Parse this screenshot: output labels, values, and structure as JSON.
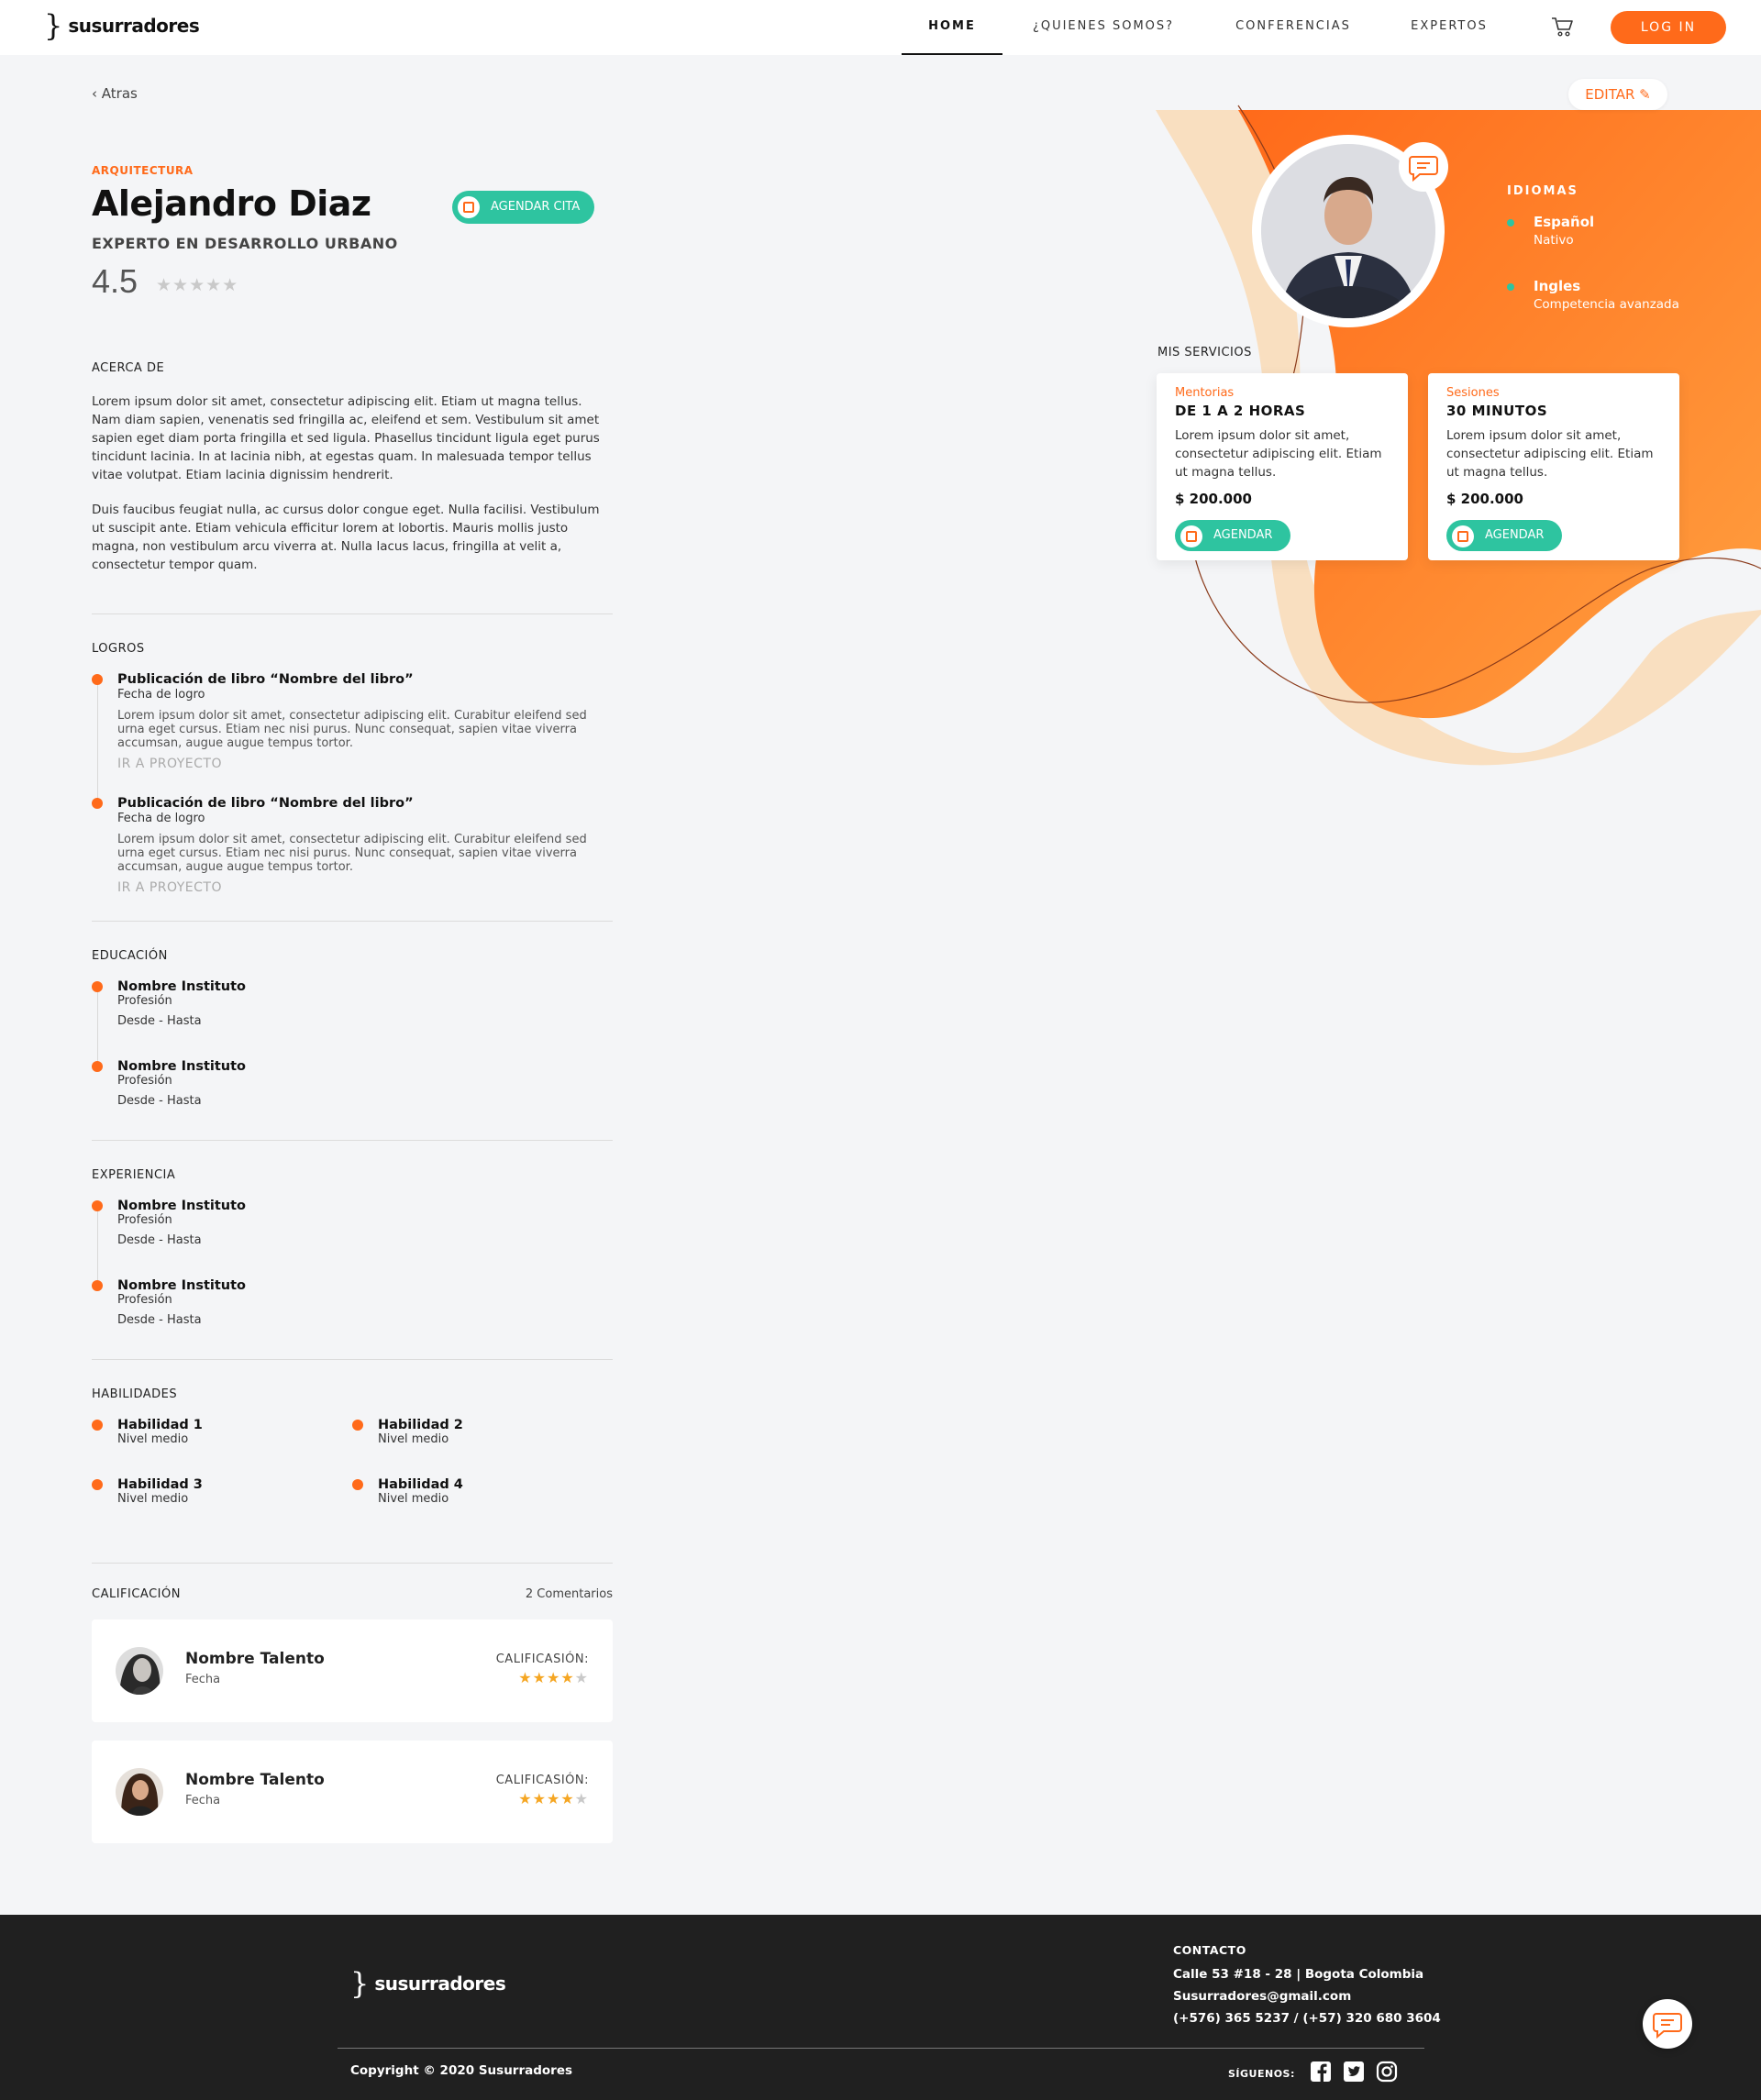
{
  "brand": {
    "name": "susurradores",
    "mark": "}",
    "accent": "#ff6a1a",
    "green": "#2ec4a0"
  },
  "nav": {
    "items": [
      {
        "label": "HOME",
        "active": true
      },
      {
        "label": "¿QUIENES SOMOS?"
      },
      {
        "label": "CONFERENCIAS"
      },
      {
        "label": "EXPERTOS"
      }
    ],
    "cart_icon": "cart-icon",
    "login_label": "LOG IN"
  },
  "back_label": "Atras",
  "edit_label": "EDITAR",
  "profile": {
    "category": "ARQUITECTURA",
    "name": "Alejandro Diaz",
    "title": "EXPERTO EN DESARROLLO URBANO",
    "rating": "4.5",
    "rating_value": 0,
    "book_label": "AGENDAR CITA"
  },
  "about": {
    "label": "ACERCA DE",
    "paragraphs": [
      "Lorem ipsum dolor sit amet, consectetur adipiscing elit. Etiam ut magna tellus. Nam diam sapien, venenatis sed fringilla ac, eleifend et sem. Vestibulum sit amet sapien eget diam porta fringilla et sed ligula. Phasellus tincidunt ligula eget purus tincidunt lacinia. In at lacinia nibh, at egestas quam. In malesuada tempor tellus vitae volutpat. Etiam lacinia dignissim hendrerit.",
      "Duis faucibus feugiat nulla, ac cursus dolor congue eget. Nulla facilisi. Vestibulum ut suscipit ante. Etiam vehicula efficitur lorem at lobortis. Mauris mollis justo magna, non vestibulum arcu viverra at. Nulla lacus lacus, fringilla at velit a, consectetur tempor quam."
    ]
  },
  "logros": {
    "label": "LOGROS",
    "items": [
      {
        "title": "Publicación de libro “Nombre del libro”",
        "date": "Fecha de logro",
        "desc": "Lorem ipsum dolor sit amet, consectetur adipiscing elit. Curabitur eleifend sed urna eget cursus. Etiam nec nisi purus. Nunc consequat, sapien vitae viverra accumsan, augue augue tempus tortor.",
        "link": "IR A PROYECTO"
      },
      {
        "title": "Publicación de libro “Nombre del libro”",
        "date": "Fecha de logro",
        "desc": "Lorem ipsum dolor sit amet, consectetur adipiscing elit. Curabitur eleifend sed urna eget cursus. Etiam nec nisi purus. Nunc consequat, sapien vitae viverra accumsan, augue augue tempus tortor.",
        "link": "IR A PROYECTO"
      }
    ]
  },
  "educacion": {
    "label": "EDUCACIÓN",
    "items": [
      {
        "title": "Nombre Instituto",
        "sub": "Profesión",
        "range": "Desde - Hasta"
      },
      {
        "title": "Nombre Instituto",
        "sub": "Profesión",
        "range": "Desde - Hasta"
      }
    ]
  },
  "experiencia": {
    "label": "EXPERIENCIA",
    "items": [
      {
        "title": "Nombre Instituto",
        "sub": "Profesión",
        "range": "Desde - Hasta"
      },
      {
        "title": "Nombre Instituto",
        "sub": "Profesión",
        "range": "Desde - Hasta"
      }
    ]
  },
  "habilidades": {
    "label": "HABILIDADES",
    "items": [
      {
        "title": "Habilidad 1",
        "level": "Nivel medio"
      },
      {
        "title": "Habilidad 2",
        "level": "Nivel medio"
      },
      {
        "title": "Habilidad 3",
        "level": "Nivel medio"
      },
      {
        "title": "Habilidad 4",
        "level": "Nivel medio"
      }
    ]
  },
  "calificacion": {
    "label": "CALIFICACIÓN",
    "count_label": "2 Comentarios",
    "reviews": [
      {
        "name": "Nombre Talento",
        "date": "Fecha",
        "rating_label": "CALIFICASIÓN:",
        "stars": 4
      },
      {
        "name": "Nombre Talento",
        "date": "Fecha",
        "rating_label": "CALIFICASIÓN:",
        "stars": 4
      }
    ]
  },
  "idiomas": {
    "label": "IDIOMAS",
    "items": [
      {
        "name": "Español",
        "level": "Nativo"
      },
      {
        "name": "Ingles",
        "level": "Competencia avanzada"
      }
    ]
  },
  "servicios": {
    "label": "MIS SERVICIOS",
    "items": [
      {
        "category": "Mentorias",
        "title": "DE 1 A 2 HORAS",
        "desc": "Lorem ipsum dolor sit amet, consectetur adipiscing elit. Etiam ut magna tellus.",
        "price": "$ 200.000",
        "button": "AGENDAR"
      },
      {
        "category": "Sesiones",
        "title": "30 MINUTOS",
        "desc": "Lorem ipsum dolor sit amet, consectetur adipiscing elit. Etiam ut magna tellus.",
        "price": "$ 200.000",
        "button": "AGENDAR"
      }
    ]
  },
  "footer": {
    "contact_title": "CONTACTO",
    "address": "Calle 53 #18 - 28 | Bogota Colombia",
    "email": "Susurradores@gmail.com",
    "phones": "(+576) 365 5237 / (+57) 320 680 3604",
    "copyright": "Copyright © 2020 Susurradores",
    "follow_label": "SÍGUENOS:",
    "socials": [
      "facebook-icon",
      "twitter-icon",
      "instagram-icon"
    ]
  }
}
